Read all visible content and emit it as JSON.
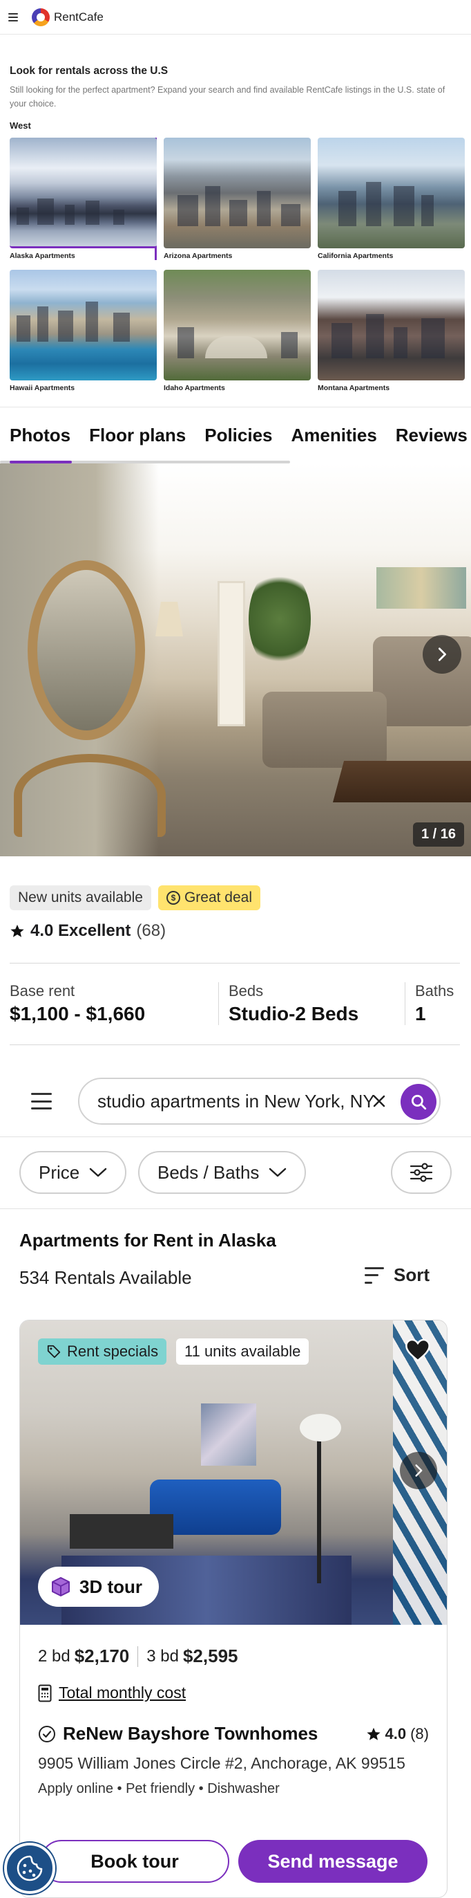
{
  "header": {
    "brand": "RentCafe"
  },
  "explore": {
    "title": "Look for rentals across the U.S",
    "description": "Still looking for the perfect apartment? Expand your search and find available RentCafe listings in the U.S. state of your choice.",
    "region": "West",
    "states": [
      {
        "label": "Alaska Apartments"
      },
      {
        "label": "Arizona Apartments"
      },
      {
        "label": "California Apartments"
      },
      {
        "label": "Hawaii Apartments"
      },
      {
        "label": "Idaho Apartments"
      },
      {
        "label": "Montana Apartments"
      }
    ]
  },
  "property": {
    "tabs": [
      "Photos",
      "Floor plans",
      "Policies",
      "Amenities",
      "Reviews"
    ],
    "gallery_counter": "1 / 16",
    "badges": {
      "new_units": "New units available",
      "deal": "Great deal"
    },
    "rating": {
      "score": "4.0 Excellent",
      "count": "(68)"
    },
    "facts": {
      "rent_label": "Base rent",
      "rent_value": "$1,100 - $1,660",
      "beds_label": "Beds",
      "beds_value": "Studio-2 Beds",
      "baths_label": "Baths",
      "baths_value": "1"
    }
  },
  "search": {
    "query": "studio apartments in New York, NY",
    "filters": {
      "price": "Price",
      "beds_baths": "Beds / Baths"
    },
    "results_title": "Apartments for Rent in Alaska",
    "results_count": "534 Rentals Available",
    "sort_label": "Sort"
  },
  "listing": {
    "tag_specials": "Rent specials",
    "tag_units": "11 units available",
    "tour_label": "3D tour",
    "prices": [
      {
        "beds": "2 bd",
        "price": "$2,170"
      },
      {
        "beds": "3 bd",
        "price": "$2,595"
      }
    ],
    "monthly_cost_label": "Total monthly cost",
    "name": "ReNew Bayshore Townhomes",
    "rating": "4.0",
    "rating_count": "(8)",
    "address": "9905 William Jones Circle #2, Anchorage, AK 99515",
    "amenities": "Apply online • Pet friendly • Dishwasher"
  },
  "actions": {
    "book": "Book tour",
    "message": "Send message"
  },
  "colors": {
    "accent": "#7b2fbe",
    "deal_yellow": "#ffe36e",
    "specials_teal": "#7fd3d0",
    "cookie_blue": "#1d4f87"
  }
}
